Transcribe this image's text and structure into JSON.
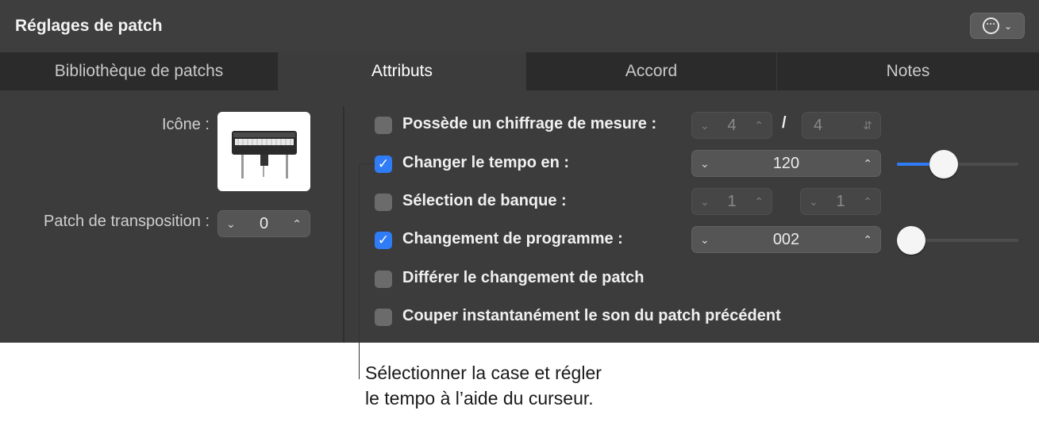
{
  "header": {
    "title": "Réglages de patch",
    "action_icon": "ellipsis-circle-icon"
  },
  "tabs": [
    {
      "label": "Bibliothèque de patchs",
      "active": false
    },
    {
      "label": "Attributs",
      "active": true
    },
    {
      "label": "Accord",
      "active": false
    },
    {
      "label": "Notes",
      "active": false
    }
  ],
  "left": {
    "icon_label": "Icône :",
    "icon_image": "electric-piano-icon",
    "transpose_label": "Patch de transposition :",
    "transpose_value": "0"
  },
  "options": {
    "time_signature": {
      "label": "Possède un chiffrage de mesure :",
      "checked": false,
      "numerator": "4",
      "separator": "/",
      "denominator": "4"
    },
    "tempo": {
      "label": "Changer le tempo en :",
      "checked": true,
      "value": "120",
      "slider_level": 0.35
    },
    "bank": {
      "label": "Sélection de banque :",
      "checked": false,
      "msb": "1",
      "lsb": "1"
    },
    "program": {
      "label": "Changement de programme :",
      "checked": true,
      "value": "002",
      "slider_level": 0.0
    },
    "defer": {
      "label": "Différer le changement de patch",
      "checked": false
    },
    "mute": {
      "label": "Couper instantanément le son du patch précédent",
      "checked": false
    }
  },
  "callout": {
    "line1": "Sélectionner la case et régler",
    "line2": "le tempo à l’aide du curseur."
  },
  "colors": {
    "accent": "#2f7cf6",
    "panel": "#3c3c3c"
  }
}
